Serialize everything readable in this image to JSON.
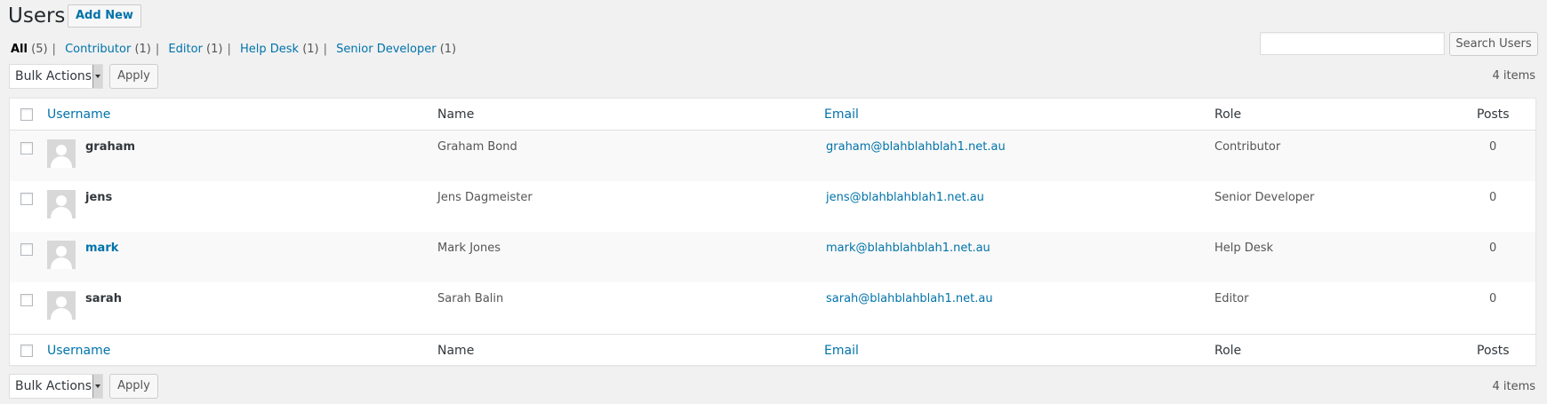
{
  "header": {
    "title": "Users",
    "add_new": "Add New"
  },
  "filters": [
    {
      "label": "All",
      "count": "(5)"
    },
    {
      "label": "Contributor",
      "count": "(1)"
    },
    {
      "label": "Editor",
      "count": "(1)"
    },
    {
      "label": "Help Desk",
      "count": "(1)"
    },
    {
      "label": "Senior Developer",
      "count": "(1)"
    }
  ],
  "filter_separator": "|",
  "search": {
    "value": "",
    "button": "Search Users"
  },
  "tablenav": {
    "bulk_actions": "Bulk Actions",
    "apply": "Apply",
    "items_count": "4 items"
  },
  "columns": {
    "username": "Username",
    "name": "Name",
    "email": "Email",
    "role": "Role",
    "posts": "Posts"
  },
  "users": [
    {
      "username": "graham",
      "name": "Graham Bond",
      "email": "graham@blahblahblah1.net.au",
      "role": "Contributor",
      "posts": "0"
    },
    {
      "username": "jens",
      "name": "Jens Dagmeister",
      "email": "jens@blahblahblah1.net.au",
      "role": "Senior Developer",
      "posts": "0"
    },
    {
      "username": "mark",
      "name": "Mark Jones",
      "email": "mark@blahblahblah1.net.au",
      "role": "Help Desk",
      "posts": "0"
    },
    {
      "username": "sarah",
      "name": "Sarah Balin",
      "email": "sarah@blahblahblah1.net.au",
      "role": "Editor",
      "posts": "0"
    }
  ],
  "colors": {
    "link": "#0073aa",
    "background": "#f1f1f1",
    "row_alt": "#f9f9f9"
  }
}
